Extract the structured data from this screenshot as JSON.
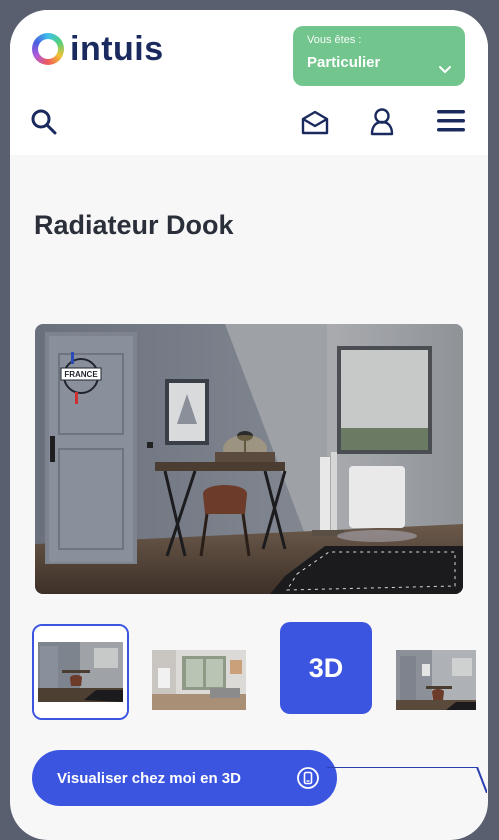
{
  "brand": {
    "name": "intuis"
  },
  "profile": {
    "caption": "Vous êtes :",
    "value": "Particulier"
  },
  "product": {
    "title": "Radiateur Dook",
    "badge_text": "FRANCE"
  },
  "thumbnails": {
    "three_d_label": "3D"
  },
  "cta": {
    "label": "Visualiser chez moi en 3D"
  },
  "icons": {
    "search": "search-icon",
    "mail": "mail-icon",
    "account": "user-icon",
    "menu": "menu-icon",
    "chevron": "chevron-down-icon",
    "phone": "phone-icon"
  },
  "colors": {
    "brand_navy": "#1a2a5e",
    "profile_green": "#72c58c",
    "accent_blue": "#3b55e0",
    "page_bg": "#f7f7f8"
  }
}
